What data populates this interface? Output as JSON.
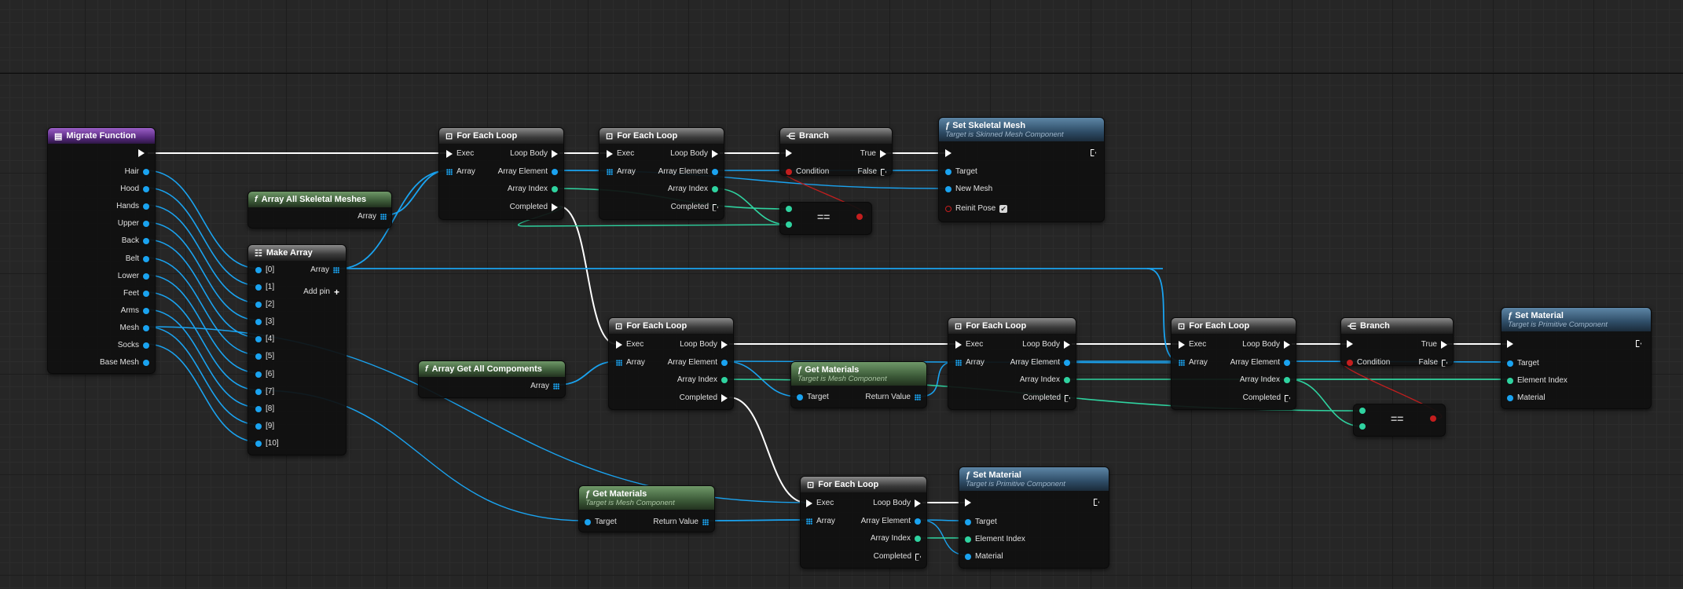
{
  "nodes": {
    "migrate": {
      "title": "Migrate Function",
      "outputs": [
        "Hair",
        "Hood",
        "Hands",
        "Upper",
        "Back",
        "Belt",
        "Lower",
        "Feet",
        "Arms",
        "Mesh",
        "Socks",
        "Base Mesh"
      ]
    },
    "skeletal": {
      "title": "Array All Skeletal Meshes",
      "out": "Array"
    },
    "make_array": {
      "title": "Make Array",
      "inputs": [
        "[0]",
        "[1]",
        "[2]",
        "[3]",
        "[4]",
        "[5]",
        "[6]",
        "[7]",
        "[8]",
        "[9]",
        "[10]"
      ],
      "out": "Array",
      "add_pin": "Add pin"
    },
    "get_comp": {
      "title": "Array Get All Compoments",
      "out": "Array"
    },
    "fe1": {
      "title": "For Each Loop",
      "exec": "Exec",
      "array": "Array",
      "loop_body": "Loop Body",
      "elem": "Array Element",
      "index": "Array Index",
      "completed": "Completed"
    },
    "branch1": {
      "title": "Branch",
      "condition": "Condition",
      "true": "True",
      "false": "False"
    },
    "branch2": {
      "title": "Branch",
      "condition": "Condition",
      "true": "True",
      "false": "False"
    },
    "equals": {
      "symbol": "=="
    },
    "set_skel": {
      "title": "Set Skeletal Mesh",
      "subtitle": "Target is Skinned Mesh Component",
      "target": "Target",
      "new_mesh": "New Mesh",
      "reinit": "Reinit Pose"
    },
    "get_mat1": {
      "title": "Get Materials",
      "subtitle": "Target is Mesh Component",
      "target": "Target",
      "ret": "Return Value"
    },
    "get_mat2": {
      "title": "Get Materials",
      "subtitle": "Target is Mesh Component",
      "target": "Target",
      "ret": "Return Value"
    },
    "set_mat": {
      "title": "Set Material",
      "subtitle": "Target is Primitive Component",
      "target": "Target",
      "element_index": "Element Index",
      "material": "Material"
    }
  },
  "colors": {
    "object_pin": "#1aa3f0",
    "int_pin": "#2fd3a0",
    "bool_pin": "#c41e1e",
    "exec": "#ffffff"
  }
}
